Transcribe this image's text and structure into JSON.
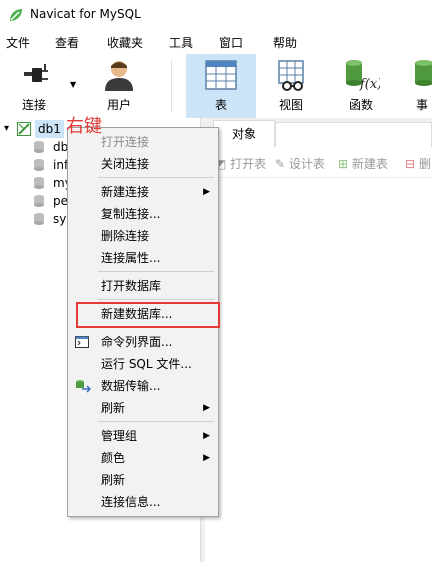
{
  "window": {
    "title": "Navicat for MySQL"
  },
  "menu": [
    "文件",
    "查看",
    "收藏夹",
    "工具",
    "窗口",
    "帮助"
  ],
  "toolbar": [
    {
      "label": "连接",
      "icon": "plug-icon"
    },
    {
      "label": "用户",
      "icon": "user-icon"
    },
    {
      "label": "表",
      "icon": "table-icon"
    },
    {
      "label": "视图",
      "icon": "view-icon"
    },
    {
      "label": "函数",
      "icon": "function-icon"
    },
    {
      "label": "事",
      "icon": "event-icon"
    }
  ],
  "tree": {
    "connection": "db1",
    "databases": [
      "db",
      "inf",
      "my",
      "pe",
      "sy"
    ]
  },
  "annotation": "右键",
  "tabs": {
    "objects": "对象"
  },
  "object_toolbar": [
    "打开表",
    "设计表",
    "新建表",
    "删"
  ],
  "context_menu": [
    {
      "label": "打开连接",
      "disabled": true
    },
    {
      "label": "关闭连接"
    },
    {
      "label": "新建连接",
      "submenu": true
    },
    {
      "label": "复制连接..."
    },
    {
      "label": "删除连接"
    },
    {
      "label": "连接属性..."
    },
    {
      "label": "打开数据库"
    },
    {
      "label": "新建数据库...",
      "highlighted": true
    },
    {
      "label": "命令列界面..."
    },
    {
      "label": "运行 SQL 文件..."
    },
    {
      "label": "数据传输..."
    },
    {
      "label": "刷新",
      "submenu": true
    },
    {
      "label": "管理组",
      "submenu": true
    },
    {
      "label": "颜色",
      "submenu": true
    },
    {
      "label": "刷新"
    },
    {
      "label": "连接信息..."
    }
  ],
  "colors": {
    "accent": "#cce4f7",
    "annotation": "#e53935"
  }
}
